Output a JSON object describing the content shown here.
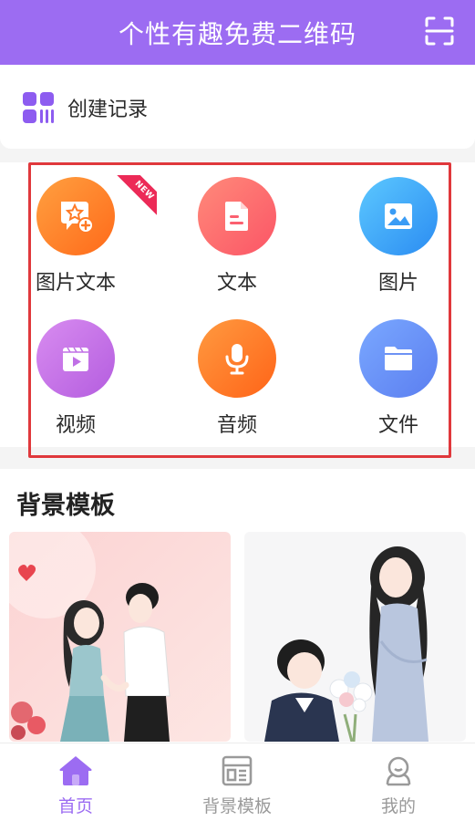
{
  "header": {
    "title": "个性有趣免费二维码"
  },
  "record": {
    "label": "创建记录"
  },
  "grid": {
    "items": [
      {
        "label": "图片文本",
        "icon": "image-text-icon",
        "badge": "NEW"
      },
      {
        "label": "文本",
        "icon": "text-document-icon"
      },
      {
        "label": "图片",
        "icon": "image-icon"
      },
      {
        "label": "视频",
        "icon": "video-icon"
      },
      {
        "label": "音频",
        "icon": "microphone-icon"
      },
      {
        "label": "文件",
        "icon": "folder-icon"
      }
    ]
  },
  "background_templates": {
    "title": "背景模板",
    "cards": [
      {
        "name": "couple-holding-hands"
      },
      {
        "name": "boy-giving-flowers"
      }
    ]
  },
  "tabs": [
    {
      "label": "首页",
      "icon": "home-icon",
      "active": true
    },
    {
      "label": "背景模板",
      "icon": "template-icon",
      "active": false
    },
    {
      "label": "我的",
      "icon": "profile-icon",
      "active": false
    }
  ],
  "colors": {
    "primary": "#9c6cf2",
    "tab_inactive": "#9a9a9a",
    "highlight_border": "#e0383c"
  }
}
